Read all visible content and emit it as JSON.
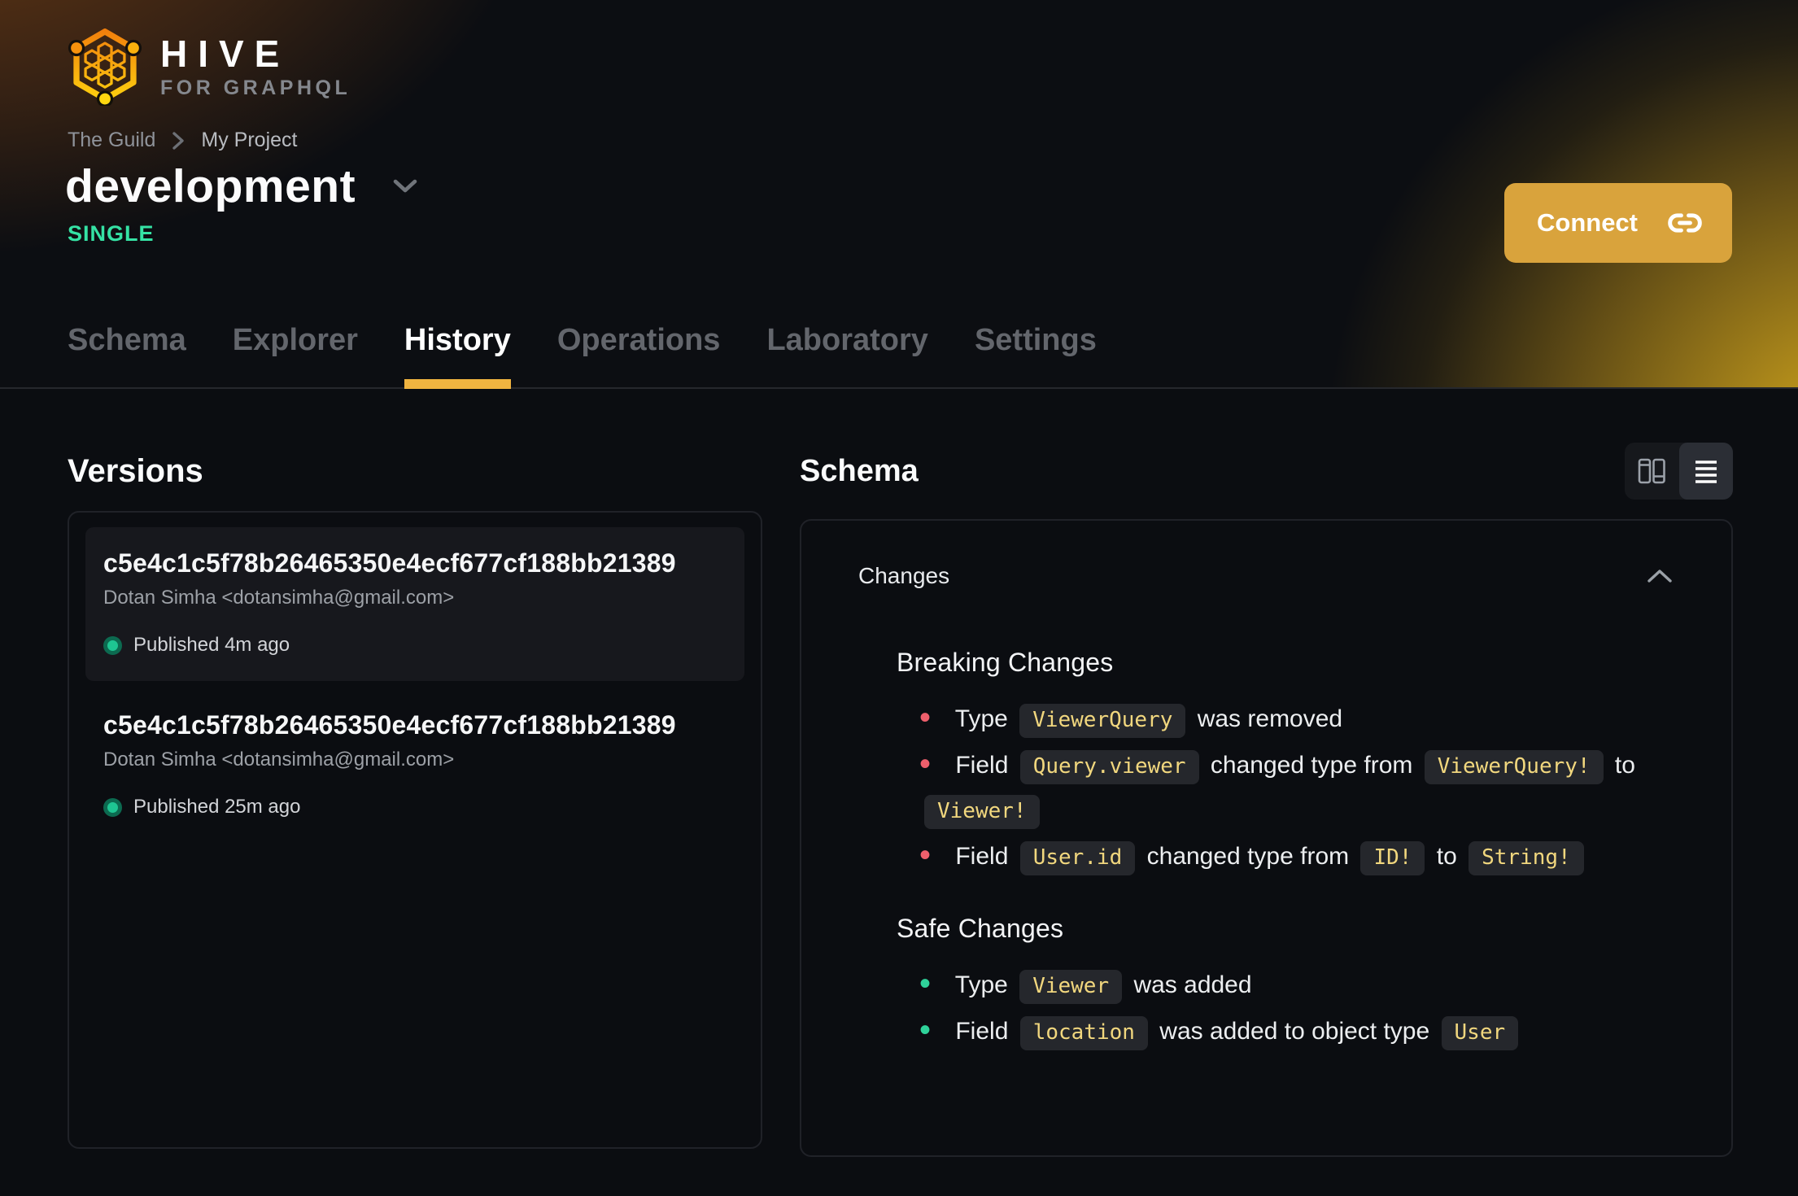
{
  "colors": {
    "accent": "#f0b440",
    "connect_bg": "#d9a33c",
    "badge_green": "#35e2a4",
    "published_dot": "#1ec592",
    "breaking_bullet": "#ee5f6c",
    "safe_bullet": "#2fd29a",
    "chip_text": "#f1d77e"
  },
  "brand": {
    "title": "HIVE",
    "subtitle": "FOR GRAPHQL",
    "logo_icon": "hive-honeycomb-icon"
  },
  "breadcrumb": {
    "items": [
      "The Guild",
      "My Project"
    ],
    "separator_icon": "chevron-right-icon"
  },
  "page": {
    "title": "development",
    "caret_icon": "chevron-down-icon",
    "badge": "SINGLE"
  },
  "connect": {
    "label": "Connect",
    "icon": "link-icon"
  },
  "tabs": [
    {
      "label": "Schema",
      "active": false
    },
    {
      "label": "Explorer",
      "active": false
    },
    {
      "label": "History",
      "active": true
    },
    {
      "label": "Operations",
      "active": false
    },
    {
      "label": "Laboratory",
      "active": false
    },
    {
      "label": "Settings",
      "active": false
    }
  ],
  "versions": {
    "heading": "Versions",
    "items": [
      {
        "hash": "c5e4c1c5f78b26465350e4ecf677cf188bb21389",
        "author": "Dotan Simha <dotansimha@gmail.com>",
        "status": "Published 4m ago",
        "current": true
      },
      {
        "hash": "c5e4c1c5f78b26465350e4ecf677cf188bb21389",
        "author": "Dotan Simha <dotansimha@gmail.com>",
        "status": "Published 25m ago",
        "current": false
      }
    ]
  },
  "schema_panel": {
    "heading": "Schema",
    "view_toggle": {
      "options": [
        {
          "icon": "columns-view-icon",
          "active": false
        },
        {
          "icon": "list-view-icon",
          "active": true
        }
      ]
    },
    "changes": {
      "header": "Changes",
      "collapse_icon": "chevron-up-icon",
      "sections": [
        {
          "title": "Breaking Changes",
          "kind": "breaking",
          "items": [
            {
              "parts": [
                {
                  "type": "text",
                  "value": "Type"
                },
                {
                  "type": "code",
                  "value": "ViewerQuery"
                },
                {
                  "type": "text",
                  "value": "was removed"
                }
              ]
            },
            {
              "parts": [
                {
                  "type": "text",
                  "value": "Field"
                },
                {
                  "type": "code",
                  "value": "Query.viewer"
                },
                {
                  "type": "text",
                  "value": "changed type from"
                },
                {
                  "type": "code",
                  "value": "ViewerQuery!"
                },
                {
                  "type": "text",
                  "value": "to"
                },
                {
                  "type": "code",
                  "value": "Viewer!"
                }
              ]
            },
            {
              "parts": [
                {
                  "type": "text",
                  "value": "Field"
                },
                {
                  "type": "code",
                  "value": "User.id"
                },
                {
                  "type": "text",
                  "value": "changed type from"
                },
                {
                  "type": "code",
                  "value": "ID!"
                },
                {
                  "type": "text",
                  "value": "to"
                },
                {
                  "type": "code",
                  "value": "String!"
                }
              ]
            }
          ]
        },
        {
          "title": "Safe Changes",
          "kind": "safe",
          "items": [
            {
              "parts": [
                {
                  "type": "text",
                  "value": "Type"
                },
                {
                  "type": "code",
                  "value": "Viewer"
                },
                {
                  "type": "text",
                  "value": "was added"
                }
              ]
            },
            {
              "parts": [
                {
                  "type": "text",
                  "value": "Field"
                },
                {
                  "type": "code",
                  "value": "location"
                },
                {
                  "type": "text",
                  "value": "was added to object type"
                },
                {
                  "type": "code",
                  "value": "User"
                }
              ]
            }
          ]
        }
      ]
    }
  }
}
